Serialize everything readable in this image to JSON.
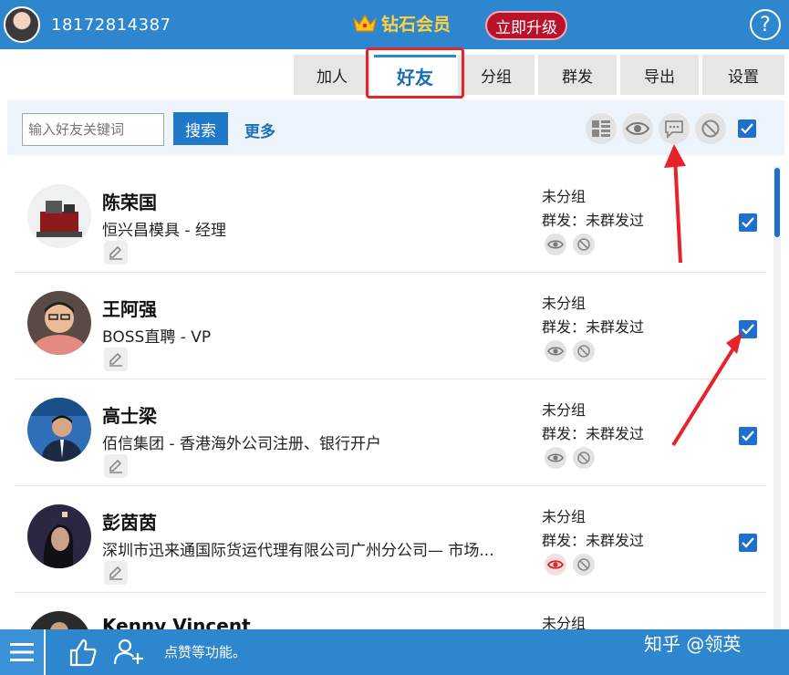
{
  "header": {
    "phone": "18172814387",
    "vip_label": "钻石会员",
    "upgrade_label": "立即升级",
    "help_label": "?"
  },
  "tabs": [
    {
      "label": "加人"
    },
    {
      "label": "好友"
    },
    {
      "label": "分组"
    },
    {
      "label": "群发"
    },
    {
      "label": "导出"
    },
    {
      "label": "设置"
    }
  ],
  "active_tab": "好友",
  "search": {
    "placeholder": "输入好友关键词",
    "button_label": "搜索",
    "more_label": "更多"
  },
  "contacts": [
    {
      "name": "陈荣国",
      "company": "恒兴昌模具 - 经理",
      "group": "未分组",
      "mass": "群发：未群发过",
      "eye_color": "#777777",
      "checked": true
    },
    {
      "name": "王阿强",
      "company": "BOSS直聘 - VP",
      "group": "未分组",
      "mass": "群发：未群发过",
      "eye_color": "#777777",
      "checked": true
    },
    {
      "name": "高士梁",
      "company": "佰信集团 - 香港海外公司注册、银行开户",
      "group": "未分组",
      "mass": "群发：未群发过",
      "eye_color": "#777777",
      "checked": true
    },
    {
      "name": "彭茵茵",
      "company": "深圳市迅来通国际货运代理有限公司广州分公司— 市场...",
      "group": "未分组",
      "mass": "群发：未群发过",
      "eye_color": "#e12020",
      "checked": true
    },
    {
      "name": "Kenny Vincent",
      "company": "",
      "group": "未分组",
      "mass": "",
      "eye_color": "#777777",
      "checked": false
    }
  ],
  "footer": {
    "tip": "点赞等功能。",
    "watermark": "知乎 @领英"
  },
  "colors": {
    "brand_blue": "#2e86cf",
    "upgrade_red": "#b8132b",
    "highlight_red": "#e8222a",
    "vip_gold": "#ffd23f"
  }
}
